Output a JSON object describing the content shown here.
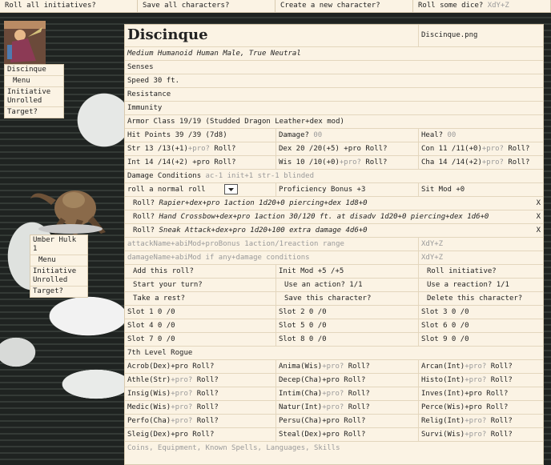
{
  "topbar": {
    "roll_all": "Roll all initiatives?",
    "save_all": "Save all characters?",
    "create": "Create a new character?",
    "roll_dice": "Roll some dice?",
    "dice_hint": "XdY+Z"
  },
  "tokens": [
    {
      "name": "Discinque",
      "menu": "Menu",
      "initiative": "Initiative Unrolled",
      "target": "Target?"
    },
    {
      "name": "Umber Hulk 1",
      "menu": "Menu",
      "initiative": "Initiative Unrolled",
      "target": "Target?"
    }
  ],
  "sheet": {
    "name": "Discinque",
    "image_file": "Discinque.png",
    "description": "Medium Humanoid Human Male, True Neutral",
    "senses": "Senses",
    "speed_label": "Speed",
    "speed": "30 ft.",
    "resistance": "Resistance",
    "immunity": "Immunity",
    "ac": "Armor Class 19/19 (Studded Dragon Leather+dex mod)",
    "hp": "Hit Points 39 /39  (7d8)",
    "damage_label": "Damage?",
    "damage_val": "00",
    "heal_label": "Heal?",
    "heal_val": "00",
    "abilities": [
      {
        "text": "Str 13 /13(+1)",
        "pro": "+pro?",
        "roll": "Roll?",
        "pro_hint": true
      },
      {
        "text": "Dex 20 /20(+5)",
        "pro": "+pro",
        "roll": "Roll?",
        "pro_hint": false
      },
      {
        "text": "Con 11 /11(+0)",
        "pro": "+pro?",
        "roll": "Roll?",
        "pro_hint": true
      },
      {
        "text": "Int 14 /14(+2)",
        "pro": "+pro",
        "roll": "Roll?",
        "pro_hint": false
      },
      {
        "text": "Wis 10 /10(+0)",
        "pro": "+pro?",
        "roll": "Roll?",
        "pro_hint": true
      },
      {
        "text": "Cha 14 /14(+2)",
        "pro": "+pro?",
        "roll": "Roll?",
        "pro_hint": true
      }
    ],
    "damage_conditions_label": "Damage Conditions",
    "damage_conditions": "ac-1 init+1 str-1 blinded",
    "roll_mode": "roll  a normal roll",
    "proficiency": "Proficiency Bonus +3",
    "sit_mod": "Sit Mod +0",
    "attacks": [
      {
        "roll": "Roll?",
        "text": "Rapier+dex+pro 1action 1d20+0 piercing+dex 1d8+0",
        "x": "X"
      },
      {
        "roll": "Roll?",
        "text": "Hand Crossbow+dex+pro 1action 30/120 ft. at disadv 1d20+0 piercing+dex 1d6+0",
        "x": "X"
      },
      {
        "roll": "Roll?",
        "text": "Sneak Attack+dex+pro 1d20+100 extra damage 4d6+0",
        "x": "X"
      }
    ],
    "attack_placeholder": "attackName+abiMod+proBonus 1action/1reaction range",
    "damage_placeholder": "damageName+abiMod if any+damage conditions",
    "dice_placeholder": "XdY+Z",
    "add_roll": "Add this roll?",
    "init_mod": "Init Mod +5 /+5",
    "roll_initiative": "Roll initiative?",
    "start_turn": "Start your turn?",
    "use_action": "Use an action?  1/1",
    "use_reaction": "Use a reaction?  1/1",
    "take_rest": "Take a rest?",
    "save_character": "Save this character?",
    "delete_character": "Delete this character?",
    "slots": [
      "Slot 1 0 /0",
      "Slot 2 0 /0",
      "Slot 3 0 /0",
      "Slot 4 0 /0",
      "Slot 5 0 /0",
      "Slot 6 0 /0",
      "Slot 7 0 /0",
      "Slot 8 0 /0",
      "Slot 9 0 /0"
    ],
    "class_level": "7th Level Rogue",
    "skills": [
      {
        "name": "Acrob(Dex)",
        "pro": "+pro",
        "hint": false
      },
      {
        "name": "Anima(Wis)",
        "pro": "+pro?",
        "hint": true
      },
      {
        "name": "Arcan(Int)",
        "pro": "+pro?",
        "hint": true
      },
      {
        "name": "Athle(Str)",
        "pro": "+pro?",
        "hint": true
      },
      {
        "name": "Decep(Cha)",
        "pro": "+pro",
        "hint": false
      },
      {
        "name": "Histo(Int)",
        "pro": "+pro?",
        "hint": true
      },
      {
        "name": "Insig(Wis)",
        "pro": "+pro?",
        "hint": true
      },
      {
        "name": "Intim(Cha)",
        "pro": "+pro?",
        "hint": true
      },
      {
        "name": "Inves(Int)",
        "pro": "+pro",
        "hint": false
      },
      {
        "name": "Medic(Wis)",
        "pro": "+pro?",
        "hint": true
      },
      {
        "name": "Natur(Int)",
        "pro": "+pro?",
        "hint": true
      },
      {
        "name": "Perce(Wis)",
        "pro": "+pro",
        "hint": false
      },
      {
        "name": "Perfo(Cha)",
        "pro": "+pro?",
        "hint": true
      },
      {
        "name": "Persu(Cha)",
        "pro": "+pro",
        "hint": false
      },
      {
        "name": "Relig(Int)",
        "pro": "+pro?",
        "hint": true
      },
      {
        "name": "Sleig(Dex)",
        "pro": "+pro",
        "hint": false
      },
      {
        "name": "Steal(Dex)",
        "pro": "+pro",
        "hint": false
      },
      {
        "name": "Survi(Wis)",
        "pro": "+pro?",
        "hint": true
      }
    ],
    "skill_roll": "Roll?",
    "notes_placeholder": "Coins, Equipment, Known Spells, Languages, Skills"
  }
}
